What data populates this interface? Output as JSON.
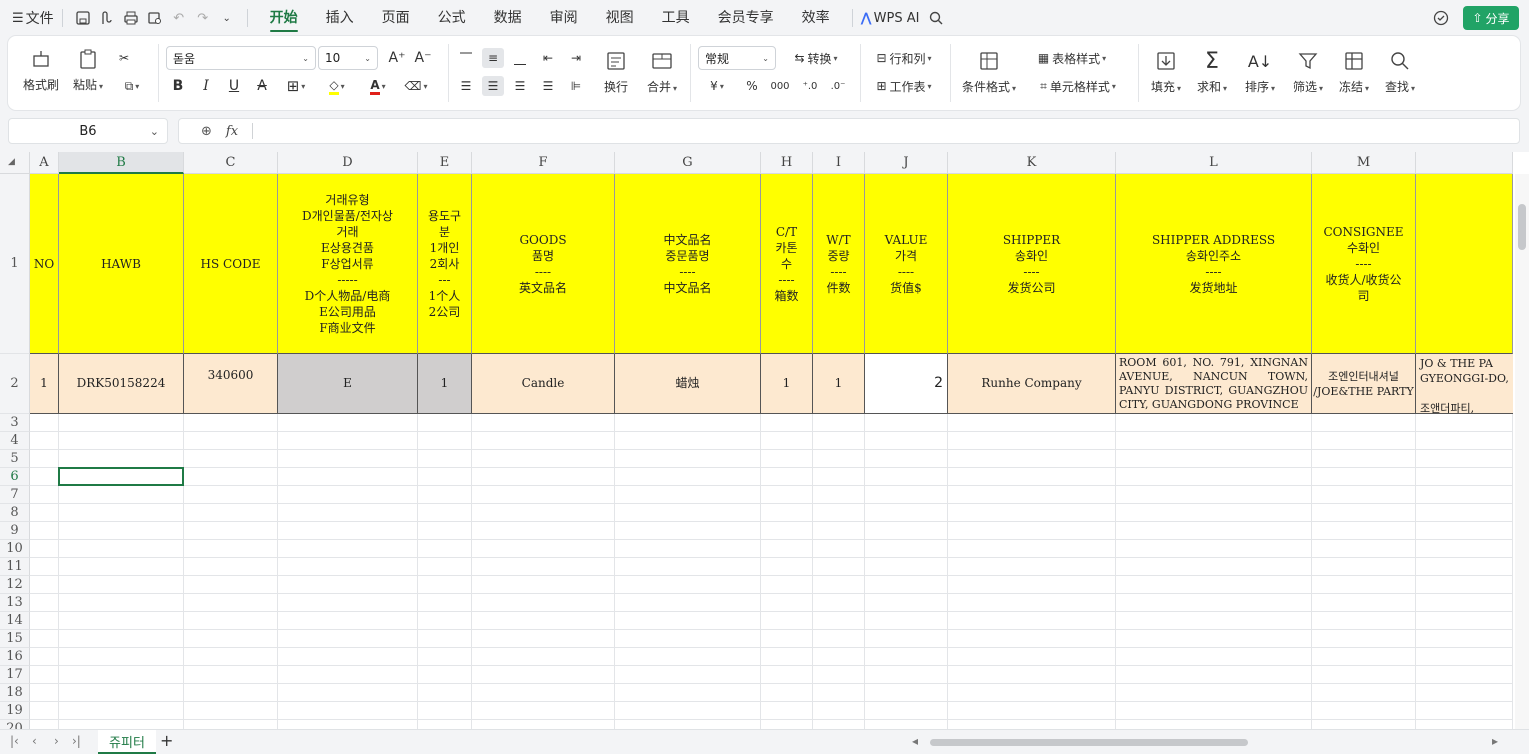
{
  "menubar": {
    "file": "文件",
    "tabs": [
      "开始",
      "插入",
      "页面",
      "公式",
      "数据",
      "审阅",
      "视图",
      "工具",
      "会员专享",
      "效率"
    ],
    "active_tab": "开始",
    "wps_ai": "WPS AI",
    "share": "分享"
  },
  "ribbon": {
    "format_painter": "格式刷",
    "paste": "粘贴",
    "font_name": "돋움",
    "font_size": "10",
    "bold": "B",
    "italic": "I",
    "underline": "U",
    "strike": "A",
    "wrap": "换行",
    "merge": "合并",
    "number_format": "常规",
    "convert": "转换",
    "currency": "¥",
    "percent": "%",
    "thousands": "000",
    "rows_cols": "行和列",
    "worksheet": "工作表",
    "cond_format": "条件格式",
    "table_style": "表格样式",
    "cell_style": "单元格样式",
    "fill": "填充",
    "sum": "求和",
    "sort": "排序",
    "filter": "筛选",
    "freeze": "冻结",
    "find": "查找"
  },
  "formula_bar": {
    "name_box": "B6",
    "fx": "fx",
    "value": ""
  },
  "columns": [
    "A",
    "B",
    "C",
    "D",
    "E",
    "F",
    "G",
    "H",
    "I",
    "J",
    "K",
    "L",
    "M",
    ""
  ],
  "selected_column": "B",
  "rows": [
    "1",
    "2",
    "3",
    "4",
    "5",
    "6",
    "7",
    "8",
    "9",
    "10",
    "11",
    "12",
    "13",
    "14",
    "15",
    "16",
    "17",
    "18",
    "19",
    "20"
  ],
  "selected_row": "6",
  "header_row": {
    "A": "NO",
    "B": "HAWB",
    "C": "HS CODE",
    "D": "거래유형\nD개인물품/전자상\n거래\nE상용견품\nF상업서류\n-----\nD个人物品/电商\nE公司用品\nF商业文件",
    "E": "용도구\n분\n1개인\n2회사\n---\n1个人\n2公司",
    "F": "GOODS\n품명\n----\n英文品名",
    "G": "中文品名\n중문품명\n----\n中文品名",
    "H": "C/T\n카톤\n수\n----\n箱数",
    "I": "W/T\n중량\n----\n件数",
    "J": "VALUE\n가격\n----\n货值$",
    "K": "SHIPPER\n송화인\n----\n发货公司",
    "L": "SHIPPER ADDRESS\n송화인주소\n----\n发货地址",
    "M": "CONSIGNEE\n수화인\n----\n收货人/收货公\n司",
    "N": ""
  },
  "data_row": {
    "A": "1",
    "B": "DRK50158224",
    "C": "340600",
    "D": "E",
    "E": "1",
    "F": "Candle",
    "G": "蜡烛",
    "H": "1",
    "I": "1",
    "J": "2",
    "K": "Runhe Company",
    "L": "ROOM 601, NO. 791, XINGNAN AVENUE, NANCUN TOWN, PANYU DISTRICT, GUANGZHOU CITY, GUANGDONG PROVINCE",
    "M": "조엔인터내셔널 /JOE&THE PARTY",
    "N": "JO & THE PA\nGYEONGGI-DO,\n\n조앤더파티,"
  },
  "sheet_tab": "쥬피터"
}
